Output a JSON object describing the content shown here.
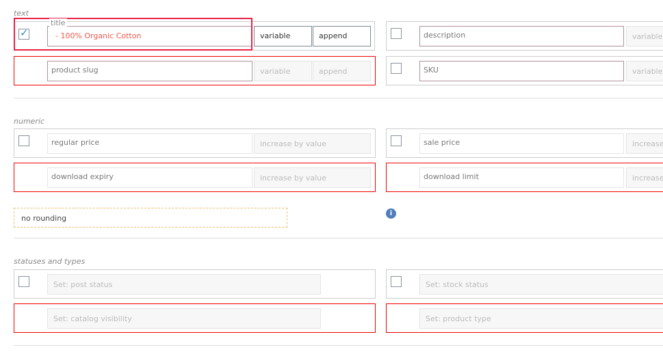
{
  "sections": {
    "text": "text",
    "numeric": "numeric",
    "statuses": "statuses and types"
  },
  "title": {
    "legend": "title",
    "value": "- 100% Organic Cotton",
    "checked": true,
    "mode": "variable",
    "action": "append"
  },
  "description": {
    "placeholder": "description",
    "mode": "variable"
  },
  "slug": {
    "placeholder": "product slug",
    "mode": "variable",
    "action": "append"
  },
  "sku": {
    "placeholder": "SKU",
    "mode": "variable"
  },
  "regular_price": {
    "placeholder": "regular price",
    "action": "increase by value"
  },
  "sale_price": {
    "placeholder": "sale price",
    "action": "increase"
  },
  "download_expiry": {
    "placeholder": "download expiry",
    "action": "increase by value"
  },
  "download_limit": {
    "placeholder": "download limit",
    "action": "increase"
  },
  "rounding": "no rounding",
  "post_status": "Set: post status",
  "stock_status": "Set: stock status",
  "catalog_visibility": "Set: catalog visibility",
  "product_type": "Set: product type",
  "colors": {
    "highlight": "#e8234a",
    "error": "#e00000",
    "check": "#2a8ccf",
    "title_text": "#f2564a"
  }
}
